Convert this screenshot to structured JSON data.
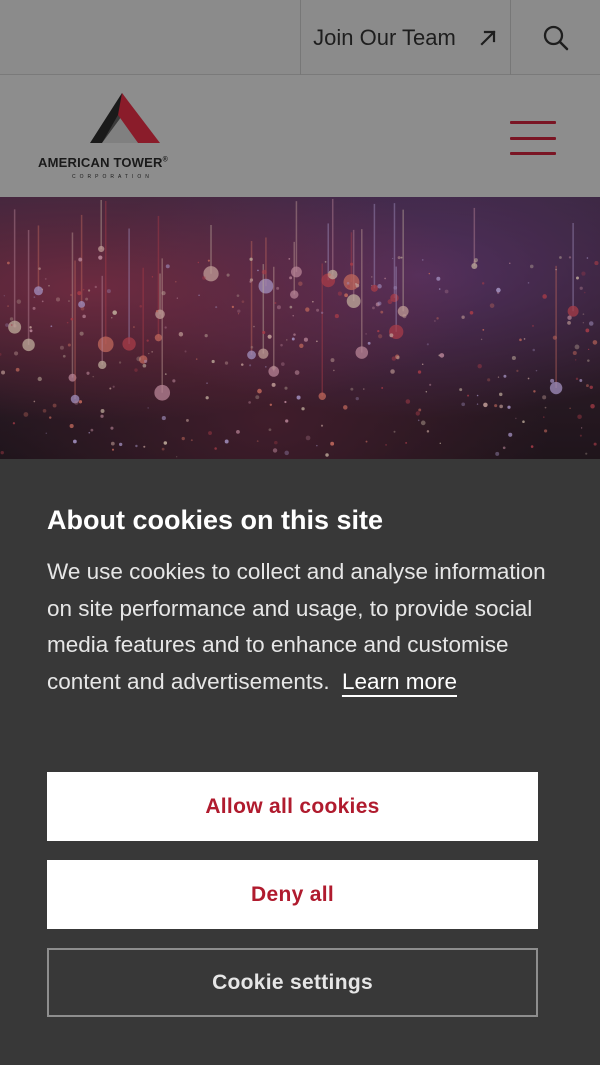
{
  "topbar": {
    "join_label": "Join Our Team",
    "join_icon": "arrow-up-right-icon",
    "search_icon": "search-icon"
  },
  "header": {
    "logo_text": "AMERICAN TOWER",
    "logo_registered": "®",
    "logo_subtext": "CORPORATION",
    "menu_icon": "hamburger-menu-icon",
    "accent_color": "#7a1524"
  },
  "cookie_banner": {
    "title": "About cookies on this site",
    "body": "We use cookies to collect and analyse information on site performance and usage, to provide social media features and to enhance and customise content and advertisements.",
    "learn_more": "Learn more",
    "allow_all": "Allow all cookies",
    "deny_all": "Deny all",
    "settings": "Cookie settings",
    "button_text_color": "#b01b2e"
  }
}
